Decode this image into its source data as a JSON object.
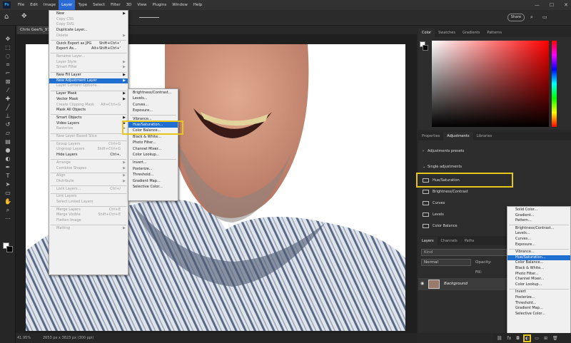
{
  "menubar": {
    "app_icon": "Ps",
    "items": [
      "File",
      "Edit",
      "Image",
      "Layer",
      "Type",
      "Select",
      "Filter",
      "3D",
      "View",
      "Plugins",
      "Window",
      "Help"
    ],
    "window_controls": [
      "—",
      "☐",
      "✕"
    ]
  },
  "optbar": {
    "share_label": "Share"
  },
  "document": {
    "tab_label": "Chris Gee%_97",
    "status_zoom": "41.95%",
    "status_size": "2653 px x 3823 px (300 ppi)"
  },
  "layer_menu": [
    {
      "label": "New",
      "arrow": true
    },
    {
      "label": "Copy CSS",
      "disabled": true
    },
    {
      "label": "Copy SVG",
      "disabled": true
    },
    {
      "label": "Duplicate Layer..."
    },
    {
      "label": "Delete",
      "arrow": true,
      "disabled": true
    },
    {
      "sep": true
    },
    {
      "label": "Quick Export as JPG",
      "shortcut": "Shift+Ctrl+'"
    },
    {
      "label": "Export As...",
      "shortcut": "Alt+Shift+Ctrl+'"
    },
    {
      "sep": true
    },
    {
      "label": "Rename Layer...",
      "disabled": true
    },
    {
      "label": "Layer Style",
      "arrow": true,
      "disabled": true
    },
    {
      "label": "Smart Filter",
      "arrow": true,
      "disabled": true
    },
    {
      "sep": true
    },
    {
      "label": "New Fill Layer",
      "arrow": true
    },
    {
      "label": "New Adjustment Layer",
      "arrow": true,
      "highlight": true
    },
    {
      "label": "Layer Content Options...",
      "disabled": true
    },
    {
      "sep": true
    },
    {
      "label": "Layer Mask",
      "arrow": true
    },
    {
      "label": "Vector Mask",
      "arrow": true
    },
    {
      "label": "Create Clipping Mask",
      "shortcut": "Alt+Ctrl+G",
      "disabled": true
    },
    {
      "label": "Mask All Objects"
    },
    {
      "sep": true
    },
    {
      "label": "Smart Objects",
      "arrow": true
    },
    {
      "label": "Video Layers",
      "arrow": true
    },
    {
      "label": "Rasterize",
      "arrow": true,
      "disabled": true
    },
    {
      "sep": true
    },
    {
      "label": "New Layer Based Slice",
      "disabled": true
    },
    {
      "sep": true
    },
    {
      "label": "Group Layers",
      "shortcut": "Ctrl+G",
      "disabled": true
    },
    {
      "label": "Ungroup Layers",
      "shortcut": "Shift+Ctrl+G",
      "disabled": true
    },
    {
      "label": "Hide Layers",
      "shortcut": "Ctrl+,"
    },
    {
      "sep": true
    },
    {
      "label": "Arrange",
      "arrow": true,
      "disabled": true
    },
    {
      "label": "Combine Shapes",
      "arrow": true,
      "disabled": true
    },
    {
      "sep": true
    },
    {
      "label": "Align",
      "arrow": true,
      "disabled": true
    },
    {
      "label": "Distribute",
      "arrow": true,
      "disabled": true
    },
    {
      "sep": true
    },
    {
      "label": "Lock Layers...",
      "shortcut": "Ctrl+/",
      "disabled": true
    },
    {
      "sep": true
    },
    {
      "label": "Link Layers",
      "disabled": true
    },
    {
      "label": "Select Linked Layers",
      "disabled": true
    },
    {
      "sep": true
    },
    {
      "label": "Merge Layers",
      "shortcut": "Ctrl+E",
      "disabled": true
    },
    {
      "label": "Merge Visible",
      "shortcut": "Shift+Ctrl+E",
      "disabled": true
    },
    {
      "label": "Flatten Image",
      "disabled": true
    },
    {
      "sep": true
    },
    {
      "label": "Matting",
      "arrow": true,
      "disabled": true
    }
  ],
  "adj_submenu": [
    {
      "label": "Brightness/Contrast..."
    },
    {
      "label": "Levels..."
    },
    {
      "label": "Curves..."
    },
    {
      "label": "Exposure..."
    },
    {
      "sep": true
    },
    {
      "label": "Vibrance..."
    },
    {
      "label": "Hue/Saturation...",
      "highlight": true
    },
    {
      "label": "Color Balance..."
    },
    {
      "label": "Black & White..."
    },
    {
      "label": "Photo Filter..."
    },
    {
      "label": "Channel Mixer..."
    },
    {
      "label": "Color Lookup..."
    },
    {
      "sep": true
    },
    {
      "label": "Invert..."
    },
    {
      "label": "Posterize..."
    },
    {
      "label": "Threshold..."
    },
    {
      "label": "Gradient Map..."
    },
    {
      "label": "Selective Color..."
    }
  ],
  "color_panel": {
    "tabs": [
      "Color",
      "Swatches",
      "Gradients",
      "Patterns"
    ]
  },
  "adj_panel": {
    "tabs": [
      "Properties",
      "Adjustments",
      "Libraries"
    ],
    "presets_label": "Adjustments presets",
    "single_label": "Single adjustments",
    "items": [
      "Hue/Saturation",
      "Brightness/Contrast",
      "Curves",
      "Levels",
      "Color Balance"
    ]
  },
  "layers_panel": {
    "tabs": [
      "Layers",
      "Channels",
      "Paths"
    ],
    "search_placeholder": "Kind",
    "blend_mode": "Normal",
    "opacity_label": "Opacity:",
    "fill_label": "Fill:",
    "layer_name": "Background"
  },
  "adj_dropdown": [
    {
      "label": "Solid Color..."
    },
    {
      "label": "Gradient..."
    },
    {
      "label": "Pattern..."
    },
    {
      "sep": true
    },
    {
      "label": "Brightness/Contrast..."
    },
    {
      "label": "Levels..."
    },
    {
      "label": "Curves..."
    },
    {
      "label": "Exposure..."
    },
    {
      "sep": true
    },
    {
      "label": "Vibrance..."
    },
    {
      "label": "Hue/Saturation...",
      "highlight": true
    },
    {
      "label": "Color Balance..."
    },
    {
      "label": "Black & White..."
    },
    {
      "label": "Photo Filter..."
    },
    {
      "label": "Channel Mixer..."
    },
    {
      "label": "Color Lookup..."
    },
    {
      "sep": true
    },
    {
      "label": "Invert"
    },
    {
      "label": "Posterize..."
    },
    {
      "label": "Threshold..."
    },
    {
      "label": "Gradient Map..."
    },
    {
      "label": "Selective Color..."
    }
  ],
  "colors": {
    "highlight": "#1f6fd0",
    "callout": "#e6c619"
  }
}
